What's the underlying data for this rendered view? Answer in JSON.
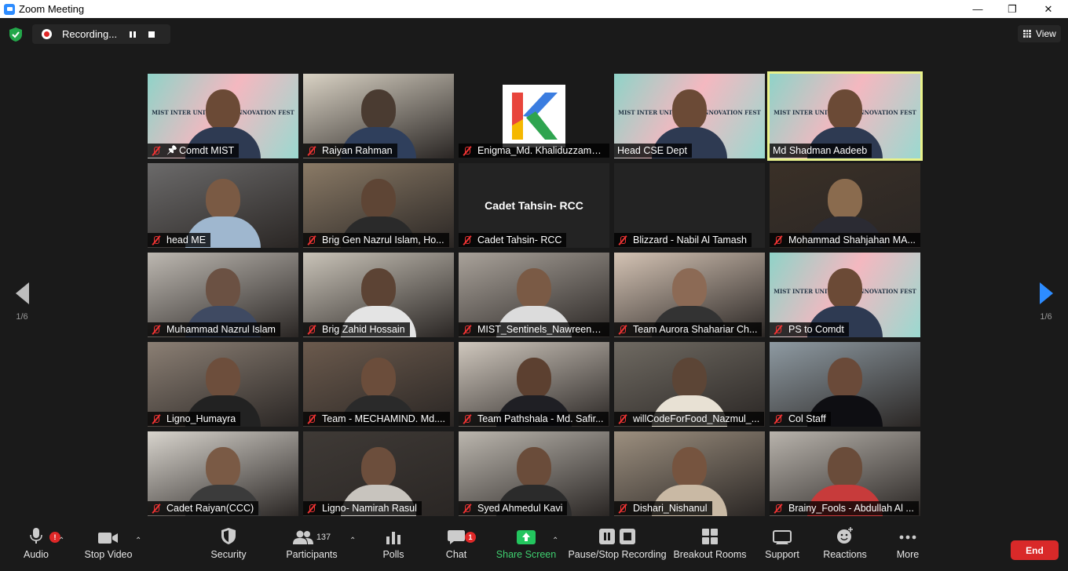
{
  "window": {
    "title": "Zoom Meeting",
    "minimize": "—",
    "maximize": "❐",
    "close": "✕"
  },
  "recording": {
    "label": "Recording..."
  },
  "view": {
    "label": "View"
  },
  "pagination": {
    "left": "1/6",
    "right": "1/6"
  },
  "participants": [
    {
      "name": "Comdt MIST",
      "muted": true,
      "pinned": true,
      "style": "banner"
    },
    {
      "name": "Raiyan Rahman",
      "muted": true,
      "style": "video"
    },
    {
      "name": "Enigma_Md. Khaliduzzama...",
      "muted": true,
      "style": "logo"
    },
    {
      "name": "Head CSE Dept",
      "muted": false,
      "style": "banner"
    },
    {
      "name": "Md Shadman Aadeeb",
      "muted": false,
      "style": "banner",
      "active": true
    },
    {
      "name": "head ME",
      "muted": true,
      "style": "video"
    },
    {
      "name": "Brig Gen Nazrul Islam, Ho...",
      "muted": true,
      "style": "video"
    },
    {
      "name": "Cadet Tahsin- RCC",
      "muted": true,
      "style": "text",
      "display_text": "Cadet Tahsin- RCC"
    },
    {
      "name": "Blizzard - Nabil Al Tamash",
      "muted": true,
      "style": "blank"
    },
    {
      "name": "Mohammad Shahjahan MA...",
      "muted": true,
      "style": "video"
    },
    {
      "name": "Muhammad Nazrul Islam",
      "muted": true,
      "style": "video"
    },
    {
      "name": "Brig Zahid Hossain",
      "muted": true,
      "style": "video"
    },
    {
      "name": "MIST_Sentinels_Nawreen_A...",
      "muted": true,
      "style": "video"
    },
    {
      "name": "Team Aurora Shahariar Ch...",
      "muted": true,
      "style": "video"
    },
    {
      "name": "PS to Comdt",
      "muted": true,
      "style": "banner"
    },
    {
      "name": "Ligno_Humayra",
      "muted": true,
      "style": "video"
    },
    {
      "name": "Team - MECHAMIND. Md....",
      "muted": true,
      "style": "video"
    },
    {
      "name": "Team Pathshala - Md. Safir...",
      "muted": true,
      "style": "video"
    },
    {
      "name": "willCodeForFood_Nazmul_...",
      "muted": true,
      "style": "video"
    },
    {
      "name": "Col Staff",
      "muted": true,
      "style": "video"
    },
    {
      "name": "Cadet Raiyan(CCC)",
      "muted": true,
      "style": "video"
    },
    {
      "name": "Ligno- Namirah Rasul",
      "muted": true,
      "style": "video"
    },
    {
      "name": "Syed Ahmedul Kavi",
      "muted": true,
      "style": "video"
    },
    {
      "name": "Dishari_Nishanul",
      "muted": true,
      "style": "video"
    },
    {
      "name": "Brainy_Fools - Abdullah Al ...",
      "muted": true,
      "style": "video"
    }
  ],
  "banner": {
    "line1": "MIST INTER UNIVERSITY INNOVATION FEST 2021"
  },
  "toolbar": {
    "audio": "Audio",
    "stop_video": "Stop Video",
    "security": "Security",
    "participants": "Participants",
    "participants_count": "137",
    "polls": "Polls",
    "chat": "Chat",
    "chat_badge": "1",
    "audio_badge": "!",
    "share_screen": "Share Screen",
    "pause_stop_recording": "Pause/Stop Recording",
    "breakout_rooms": "Breakout Rooms",
    "support": "Support",
    "reactions": "Reactions",
    "more": "More",
    "end": "End"
  },
  "colors": {
    "accent": "#2d8cff",
    "end": "#d92929",
    "share": "#23c55e",
    "active_border": "#e9f28a"
  }
}
